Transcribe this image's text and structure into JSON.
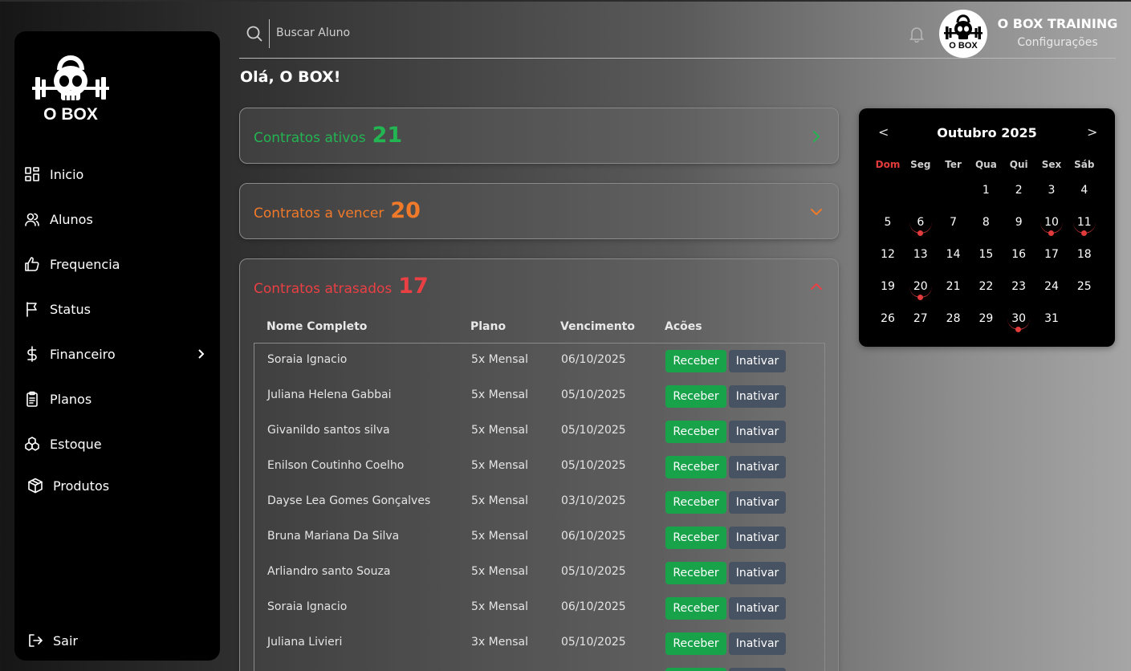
{
  "sidebar": {
    "brand": "O BOX",
    "items": [
      {
        "label": "Inicio",
        "icon": "dashboard-icon"
      },
      {
        "label": "Alunos",
        "icon": "users-icon"
      },
      {
        "label": "Frequencia",
        "icon": "thumbs-up-icon"
      },
      {
        "label": "Status",
        "icon": "flag-icon"
      },
      {
        "label": "Financeiro",
        "icon": "dollar-icon"
      },
      {
        "label": "Planos",
        "icon": "clipboard-icon"
      },
      {
        "label": "Estoque",
        "icon": "boxes-icon"
      },
      {
        "label": "Produtos",
        "icon": "package-icon"
      }
    ],
    "logout": "Sair"
  },
  "header": {
    "search_placeholder": "Buscar Aluno",
    "avatar_text": "O BOX",
    "user_name": "O BOX TRAINING",
    "settings": "Configurações"
  },
  "greeting": "Olá, O BOX!",
  "cards": {
    "active": {
      "title": "Contratos ativos",
      "count": "21",
      "color": "#22b552"
    },
    "expiring": {
      "title": "Contratos a vencer",
      "count": "20",
      "color": "#f07a2a"
    },
    "overdue": {
      "title": "Contratos atrasados",
      "count": "17",
      "color": "#ea3f43"
    }
  },
  "table": {
    "headers": [
      "Nome Completo",
      "Plano",
      "Vencimento",
      "Acões"
    ],
    "receive_label": "Receber",
    "deactivate_label": "Inativar",
    "rows": [
      [
        "Soraia Ignacio",
        "5x Mensal",
        "06/10/2025"
      ],
      [
        "Juliana Helena Gabbai",
        "5x Mensal",
        "05/10/2025"
      ],
      [
        "Givanildo santos silva",
        "5x Mensal",
        "05/10/2025"
      ],
      [
        "Enilson Coutinho Coelho",
        "5x Mensal",
        "05/10/2025"
      ],
      [
        "Dayse Lea Gomes Gonçalves",
        "5x Mensal",
        "03/10/2025"
      ],
      [
        "Bruna Mariana Da Silva",
        "5x Mensal",
        "06/10/2025"
      ],
      [
        "Arliandro santo Souza",
        "5x Mensal",
        "05/10/2025"
      ],
      [
        "Soraia Ignacio",
        "5x Mensal",
        "06/10/2025"
      ],
      [
        "Juliana Livieri",
        "3x Mensal",
        "05/10/2025"
      ],
      [
        "",
        "",
        ""
      ]
    ]
  },
  "calendar": {
    "month": "Outubro 2025",
    "prev": "<",
    "next": ">",
    "weekdays": [
      "Dom",
      "Seg",
      "Ter",
      "Qua",
      "Qui",
      "Sex",
      "Sáb"
    ],
    "first_weekday_index": 3,
    "days_in_month": 31,
    "marked_days": [
      6,
      10,
      11,
      20,
      30
    ],
    "weekend_color": "#e23b3b"
  }
}
